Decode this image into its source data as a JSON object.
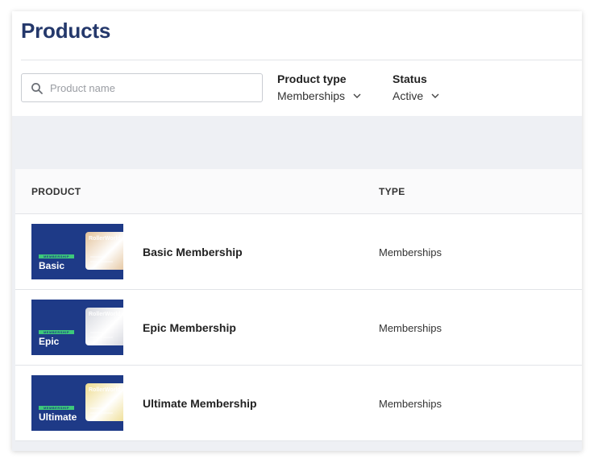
{
  "page": {
    "title": "Products"
  },
  "filters": {
    "search": {
      "placeholder": "Product name",
      "value": ""
    },
    "product_type": {
      "label": "Product type",
      "value": "Memberships"
    },
    "status": {
      "label": "Status",
      "value": "Active"
    }
  },
  "table": {
    "columns": [
      "PRODUCT",
      "TYPE"
    ],
    "rows": [
      {
        "name": "Basic Membership",
        "type": "Memberships",
        "thumb_tier": "Basic",
        "thumb_tag": "MEMBERSHIP",
        "thumb_brand": "RollerWorld",
        "card_color": "#e3c29a"
      },
      {
        "name": "Epic Membership",
        "type": "Memberships",
        "thumb_tier": "Epic",
        "thumb_tag": "MEMBERSHIP",
        "thumb_brand": "RollerWorld",
        "card_color": "#d3d5dc"
      },
      {
        "name": "Ultimate Membership",
        "type": "Memberships",
        "thumb_tier": "Ultimate",
        "thumb_tag": "MEMBERSHIP",
        "thumb_brand": "RollerWorld",
        "card_color": "#eedc8e"
      }
    ]
  },
  "icons": {
    "search": "search-icon",
    "dropdown": "chevron-down-icon"
  },
  "colors": {
    "title": "#24386b",
    "thumb_bg": "#1e3a87",
    "thumb_tag": "#3cc87a"
  }
}
